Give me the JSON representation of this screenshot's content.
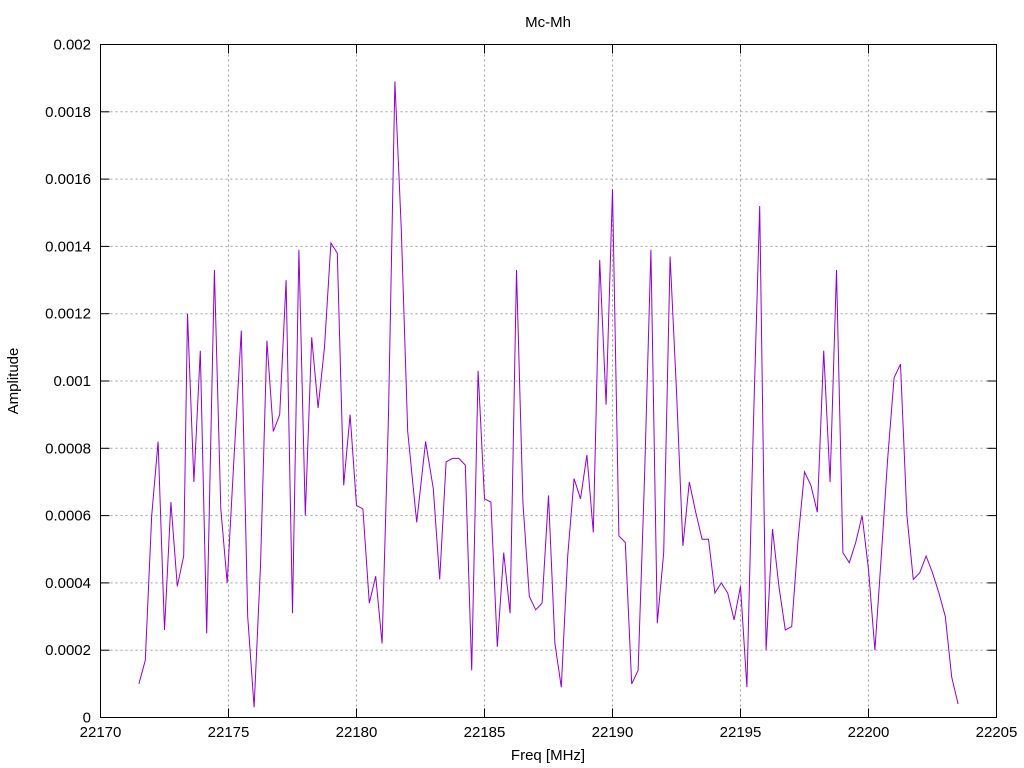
{
  "chart_data": {
    "type": "line",
    "title": "Mc-Mh",
    "xlabel": "Freq [MHz]",
    "ylabel": "Amplitude",
    "xlim": [
      22170,
      22205
    ],
    "ylim": [
      0,
      0.002
    ],
    "grid": true,
    "legend": "none",
    "x_ticks": [
      22170,
      22175,
      22180,
      22185,
      22190,
      22195,
      22200,
      22205
    ],
    "x_tick_labels": [
      "22170",
      "22175",
      "22180",
      "22185",
      "22190",
      "22195",
      "22200",
      "22205"
    ],
    "y_ticks": [
      0,
      0.0002,
      0.0004,
      0.0006,
      0.0008,
      0.001,
      0.0012,
      0.0014,
      0.0016,
      0.0018,
      0.002
    ],
    "y_tick_labels": [
      "0",
      "0.0002",
      "0.0004",
      "0.0006",
      "0.0008",
      "0.001",
      "0.0012",
      "0.0014",
      "0.0016",
      "0.0018",
      "0.002"
    ],
    "series": [
      {
        "color": "#9400d3",
        "points": [
          [
            22171.5,
            0.0001
          ],
          [
            22171.75,
            0.00017
          ],
          [
            22172.0,
            0.0006
          ],
          [
            22172.25,
            0.00082
          ],
          [
            22172.5,
            0.00026
          ],
          [
            22172.75,
            0.00064
          ],
          [
            22173.0,
            0.00039
          ],
          [
            22173.25,
            0.00048
          ],
          [
            22173.4,
            0.0012
          ],
          [
            22173.65,
            0.0007
          ],
          [
            22173.9,
            0.00109
          ],
          [
            22174.15,
            0.00025
          ],
          [
            22174.45,
            0.00133
          ],
          [
            22174.7,
            0.00062
          ],
          [
            22174.95,
            0.0004
          ],
          [
            22175.2,
            0.00075
          ],
          [
            22175.5,
            0.00115
          ],
          [
            22175.75,
            0.0003
          ],
          [
            22176.0,
            3e-05
          ],
          [
            22176.25,
            0.00045
          ],
          [
            22176.5,
            0.00112
          ],
          [
            22176.75,
            0.00085
          ],
          [
            22177.0,
            0.0009
          ],
          [
            22177.25,
            0.0013
          ],
          [
            22177.5,
            0.00031
          ],
          [
            22177.75,
            0.00139
          ],
          [
            22178.0,
            0.0006
          ],
          [
            22178.25,
            0.00113
          ],
          [
            22178.5,
            0.00092
          ],
          [
            22178.75,
            0.0011
          ],
          [
            22179.0,
            0.00141
          ],
          [
            22179.25,
            0.00138
          ],
          [
            22179.5,
            0.00069
          ],
          [
            22179.75,
            0.0009
          ],
          [
            22180.0,
            0.00063
          ],
          [
            22180.25,
            0.00062
          ],
          [
            22180.5,
            0.00034
          ],
          [
            22180.75,
            0.00042
          ],
          [
            22181.0,
            0.00022
          ],
          [
            22181.25,
            0.0009
          ],
          [
            22181.5,
            0.00189
          ],
          [
            22181.75,
            0.00145
          ],
          [
            22182.0,
            0.00085
          ],
          [
            22182.35,
            0.00058
          ],
          [
            22182.7,
            0.00082
          ],
          [
            22183.0,
            0.00068
          ],
          [
            22183.25,
            0.00041
          ],
          [
            22183.5,
            0.00076
          ],
          [
            22183.75,
            0.00077
          ],
          [
            22184.0,
            0.00077
          ],
          [
            22184.25,
            0.00075
          ],
          [
            22184.5,
            0.00014
          ],
          [
            22184.75,
            0.00103
          ],
          [
            22185.0,
            0.00065
          ],
          [
            22185.25,
            0.00064
          ],
          [
            22185.5,
            0.00021
          ],
          [
            22185.75,
            0.00049
          ],
          [
            22186.0,
            0.00031
          ],
          [
            22186.25,
            0.00133
          ],
          [
            22186.5,
            0.00064
          ],
          [
            22186.75,
            0.00036
          ],
          [
            22187.0,
            0.00032
          ],
          [
            22187.25,
            0.00034
          ],
          [
            22187.5,
            0.00066
          ],
          [
            22187.75,
            0.00022
          ],
          [
            22188.0,
            9e-05
          ],
          [
            22188.25,
            0.00048
          ],
          [
            22188.5,
            0.00071
          ],
          [
            22188.75,
            0.00065
          ],
          [
            22189.0,
            0.00078
          ],
          [
            22189.25,
            0.00055
          ],
          [
            22189.5,
            0.00136
          ],
          [
            22189.75,
            0.00093
          ],
          [
            22190.0,
            0.00157
          ],
          [
            22190.25,
            0.00054
          ],
          [
            22190.5,
            0.00052
          ],
          [
            22190.75,
            0.0001
          ],
          [
            22191.0,
            0.00014
          ],
          [
            22191.25,
            0.00071
          ],
          [
            22191.5,
            0.00139
          ],
          [
            22191.75,
            0.00028
          ],
          [
            22192.0,
            0.00049
          ],
          [
            22192.25,
            0.00137
          ],
          [
            22192.5,
            0.00097
          ],
          [
            22192.75,
            0.00051
          ],
          [
            22193.0,
            0.0007
          ],
          [
            22193.25,
            0.00061
          ],
          [
            22193.5,
            0.00053
          ],
          [
            22193.75,
            0.00053
          ],
          [
            22194.0,
            0.00037
          ],
          [
            22194.25,
            0.0004
          ],
          [
            22194.5,
            0.00037
          ],
          [
            22194.75,
            0.00029
          ],
          [
            22195.0,
            0.00039
          ],
          [
            22195.25,
            9e-05
          ],
          [
            22195.5,
            0.00086
          ],
          [
            22195.75,
            0.00152
          ],
          [
            22196.0,
            0.0002
          ],
          [
            22196.25,
            0.00056
          ],
          [
            22196.5,
            0.00039
          ],
          [
            22196.75,
            0.00026
          ],
          [
            22197.0,
            0.00027
          ],
          [
            22197.25,
            0.00053
          ],
          [
            22197.5,
            0.00073
          ],
          [
            22197.75,
            0.00069
          ],
          [
            22198.0,
            0.00061
          ],
          [
            22198.25,
            0.00109
          ],
          [
            22198.5,
            0.0007
          ],
          [
            22198.75,
            0.00133
          ],
          [
            22199.0,
            0.00049
          ],
          [
            22199.25,
            0.00046
          ],
          [
            22199.5,
            0.00052
          ],
          [
            22199.75,
            0.0006
          ],
          [
            22200.0,
            0.00044
          ],
          [
            22200.25,
            0.0002
          ],
          [
            22200.5,
            0.00048
          ],
          [
            22200.75,
            0.00077
          ],
          [
            22201.0,
            0.00101
          ],
          [
            22201.25,
            0.00105
          ],
          [
            22201.5,
            0.0006
          ],
          [
            22201.75,
            0.00041
          ],
          [
            22202.0,
            0.00043
          ],
          [
            22202.25,
            0.00048
          ],
          [
            22202.5,
            0.00043
          ],
          [
            22202.75,
            0.00037
          ],
          [
            22203.0,
            0.0003
          ],
          [
            22203.25,
            0.00012
          ],
          [
            22203.5,
            4e-05
          ]
        ]
      }
    ]
  }
}
